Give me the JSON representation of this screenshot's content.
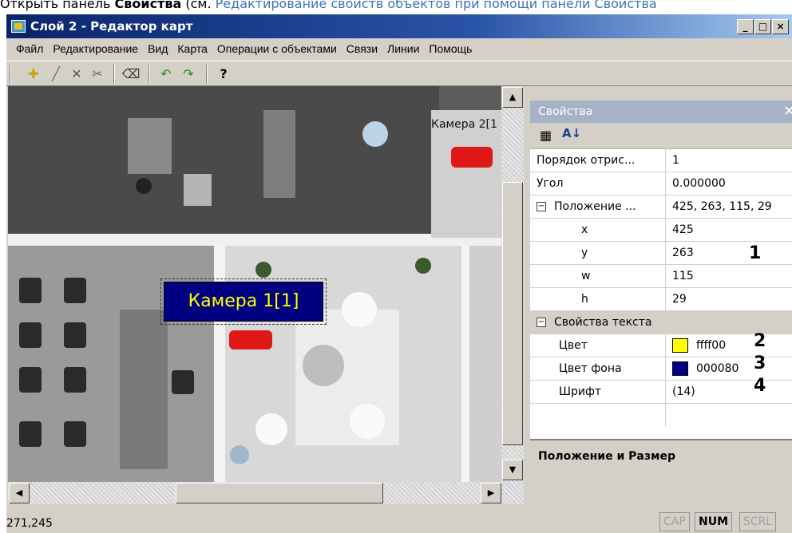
{
  "doc": {
    "prefix": "Открыть панель ",
    "bold": "Свойства",
    "mid": " (см. ",
    "link": "Редактирование свойств объектов при помощи панели Свойства"
  },
  "window": {
    "title": "Слой 2 - Редактор карт",
    "min": "_",
    "max": "□",
    "close": "×"
  },
  "menu": [
    "Файл",
    "Редактирование",
    "Вид",
    "Карта",
    "Операции с объектами",
    "Связи",
    "Линии",
    "Помощь"
  ],
  "toolbar": {
    "icons": [
      "add-point-icon",
      "line-icon",
      "delete-icon",
      "cut-icon",
      "eraser-icon",
      "undo-icon",
      "redo-icon",
      "help-icon"
    ],
    "help_label": "?"
  },
  "map": {
    "camera1_label": "Камера 1[1]",
    "camera2_label": "Камера 2[1"
  },
  "props": {
    "title": "Свойства",
    "rows": [
      {
        "key": "Порядок отрис...",
        "value": "1"
      },
      {
        "key": "Угол",
        "value": "0.000000"
      },
      {
        "key": "Положение ...",
        "value": "425, 263, 115, 29"
      },
      {
        "key": "x",
        "value": "425"
      },
      {
        "key": "y",
        "value": "263"
      },
      {
        "key": "w",
        "value": "115"
      },
      {
        "key": "h",
        "value": "29"
      },
      {
        "key": "Свойства текста",
        "value": ""
      },
      {
        "key": "Цвет",
        "value": "ffff00"
      },
      {
        "key": "Цвет фона",
        "value": "000080"
      },
      {
        "key": "Шрифт",
        "value": "(14)"
      }
    ],
    "collapse_glyph": "⊟",
    "annotations": [
      "1",
      "2",
      "3",
      "4"
    ],
    "description": "Положение и Размер",
    "colors": {
      "text": "#ffff00",
      "background": "#000080"
    }
  },
  "status": {
    "coords": "271,245",
    "caps": "CAP",
    "num": "NUM",
    "scrl": "SCRL"
  }
}
